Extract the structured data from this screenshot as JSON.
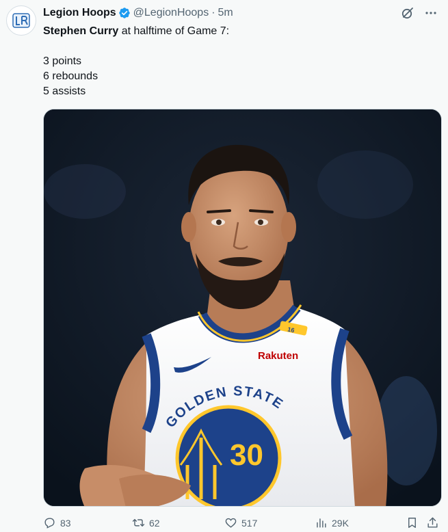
{
  "author": {
    "name": "Legion Hoops",
    "handle": "@LegionHoops",
    "separator": "·",
    "time": "5m",
    "verified_color": "#1d9bf0"
  },
  "tweet": {
    "lines": [
      {
        "bold": "Stephen Curry",
        "text": " at halftime of Game 7:"
      },
      {
        "bold": "",
        "text": ""
      },
      {
        "bold": "",
        "text": "3 points"
      },
      {
        "bold": "",
        "text": "6 rebounds"
      },
      {
        "bold": "",
        "text": "5 assists"
      }
    ]
  },
  "media": {
    "jersey_team": "GOLDEN STATE",
    "jersey_number": "30",
    "sponsor": "Rakuten",
    "strap_number": "16",
    "colors": {
      "royal": "#1d428a",
      "gold": "#ffc72c",
      "sponsor_red": "#bf0000"
    }
  },
  "actions": {
    "replies": "83",
    "reposts": "62",
    "likes": "517",
    "views": "29K"
  },
  "icons": [
    "grok-icon",
    "more-icon",
    "reply-icon",
    "repost-icon",
    "like-icon",
    "views-icon",
    "bookmark-icon",
    "share-icon"
  ]
}
